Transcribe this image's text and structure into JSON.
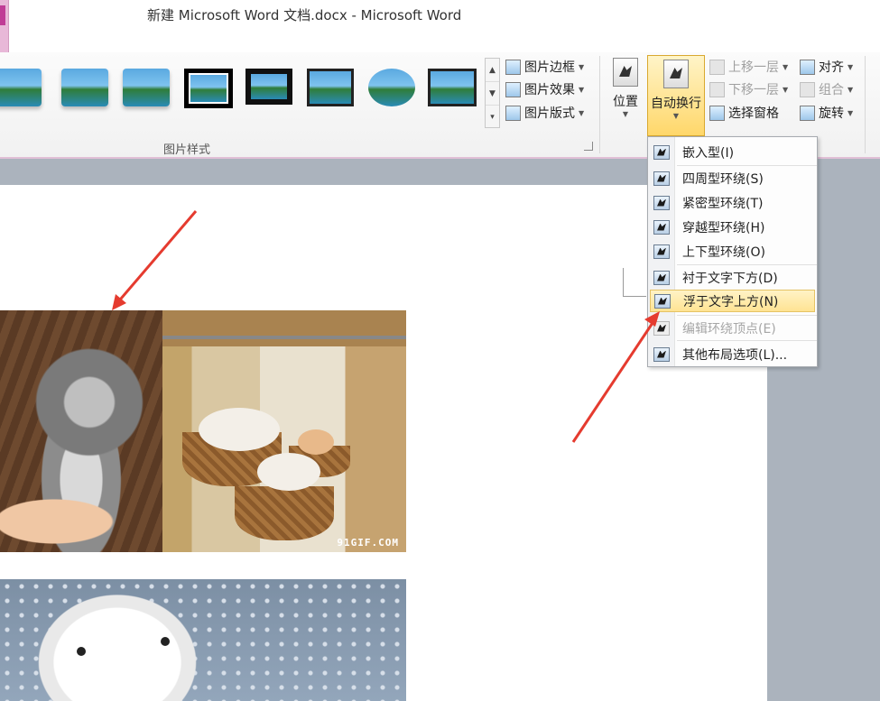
{
  "window": {
    "title": "新建 Microsoft Word 文档.docx  -  Microsoft Word"
  },
  "ribbon": {
    "picture_styles_group": {
      "label": "图片样式",
      "style_thumbnails": [
        "soft-edge",
        "soft-edge",
        "soft-edge",
        "double-frame-black",
        "thick-black-matte",
        "simple-frame-black",
        "oval",
        "metal-frame"
      ],
      "commands": [
        {
          "label": "图片边框",
          "icon": "picture-border-icon"
        },
        {
          "label": "图片效果",
          "icon": "picture-effects-icon"
        },
        {
          "label": "图片版式",
          "icon": "picture-layout-icon"
        }
      ]
    },
    "arrange_group": {
      "position_label": "位置",
      "wrap_text_label": "自动换行",
      "selection_pane_label": "选择窗格",
      "bring_forward_label": "上移一层",
      "send_backward_label": "下移一层",
      "align_label": "对齐",
      "group_label": "组合",
      "rotate_label": "旋转"
    }
  },
  "wrap_menu": {
    "items": [
      {
        "label": "嵌入型(I)",
        "state": "normal"
      },
      {
        "label": "四周型环绕(S)",
        "state": "normal"
      },
      {
        "label": "紧密型环绕(T)",
        "state": "normal"
      },
      {
        "label": "穿越型环绕(H)",
        "state": "normal"
      },
      {
        "label": "上下型环绕(O)",
        "state": "normal"
      },
      {
        "label": "衬于文字下方(D)",
        "state": "normal"
      },
      {
        "label": "浮于文字上方(N)",
        "state": "highlighted"
      },
      {
        "label": "编辑环绕顶点(E)",
        "state": "disabled"
      },
      {
        "label": "其他布局选项(L)...",
        "state": "normal"
      }
    ]
  },
  "document": {
    "images": [
      {
        "description_name": "kitten-photo"
      },
      {
        "description_name": "cats-in-baskets-photo",
        "watermark": "91GIF.COM"
      },
      {
        "description_name": "white-kitten-photo"
      }
    ]
  },
  "colors": {
    "accent": "#c03c96",
    "highlight": "#ffe393",
    "annotation_arrow": "#e53b2f"
  }
}
